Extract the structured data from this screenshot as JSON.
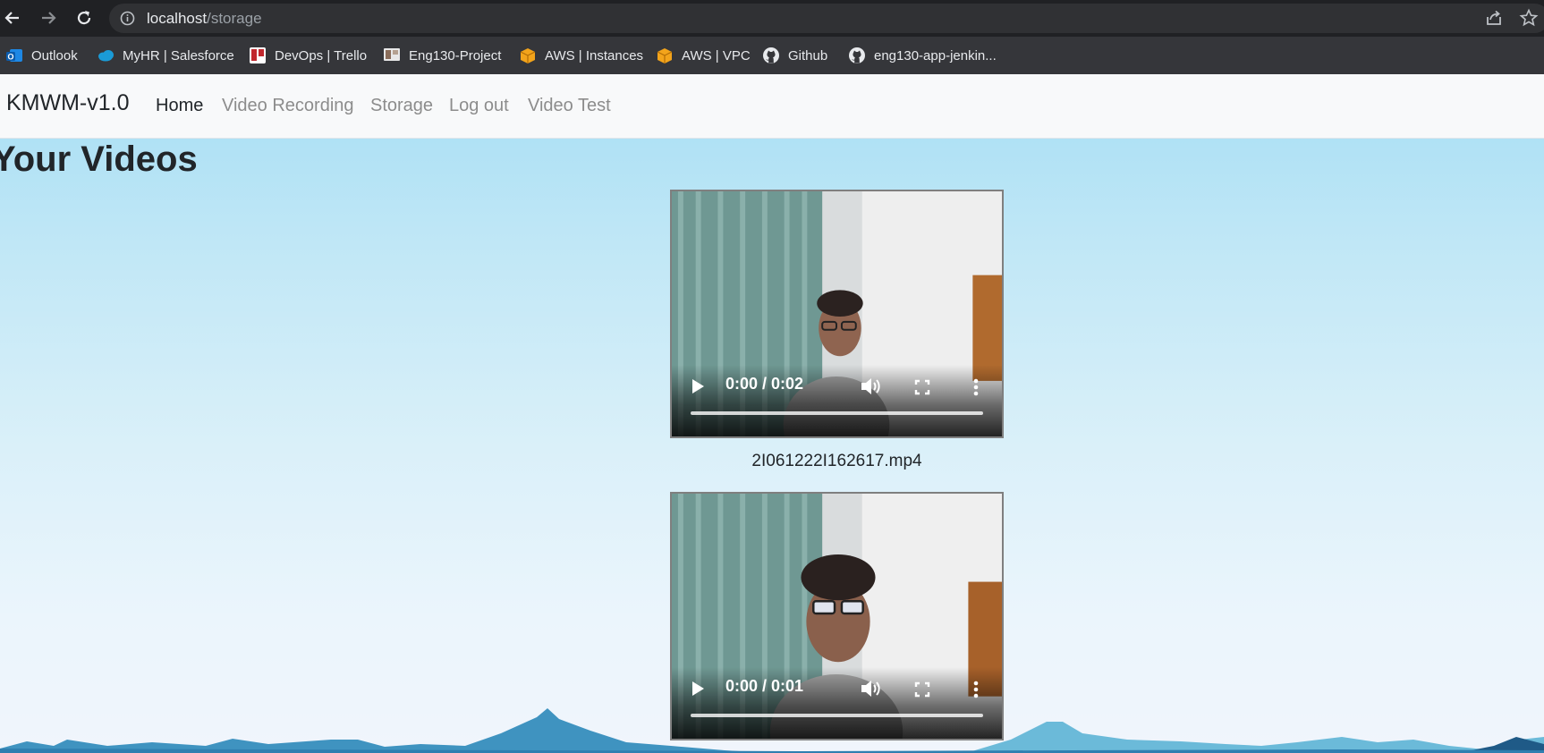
{
  "browser": {
    "url_host": "localhost",
    "url_path": "/storage",
    "bookmarks": [
      {
        "label": "Outlook",
        "icon": "outlook-icon"
      },
      {
        "label": "MyHR | Salesforce",
        "icon": "salesforce-cloud-icon"
      },
      {
        "label": "DevOps | Trello",
        "icon": "trello-icon"
      },
      {
        "label": "Eng130-Project",
        "icon": "project-icon"
      },
      {
        "label": "AWS | Instances",
        "icon": "aws-box-icon"
      },
      {
        "label": "AWS | VPC",
        "icon": "aws-box-icon"
      },
      {
        "label": "Github",
        "icon": "github-icon"
      },
      {
        "label": "eng130-app-jenkin...",
        "icon": "github-icon"
      }
    ]
  },
  "navbar": {
    "brand": "KMWM-v1.0",
    "links": [
      {
        "label": "Home",
        "active": true
      },
      {
        "label": "Video Recording",
        "active": false
      },
      {
        "label": "Storage",
        "active": false
      },
      {
        "label": "Log out",
        "active": false
      },
      {
        "label": "Video Test",
        "active": false
      }
    ]
  },
  "page": {
    "heading": "Your Videos",
    "videos": [
      {
        "time": "0:00 / 0:02",
        "filename": "2I061222I162617.mp4"
      },
      {
        "time": "0:00 / 0:01",
        "filename": ""
      }
    ]
  },
  "colors": {
    "chrome_bg": "#202124",
    "bookmarks_bg": "#35363a",
    "navbar_bg": "#f8f9fa",
    "sky_top": "#a6def4",
    "sky_bottom": "#f0f5fc",
    "mountain": "#3b8fbf"
  }
}
